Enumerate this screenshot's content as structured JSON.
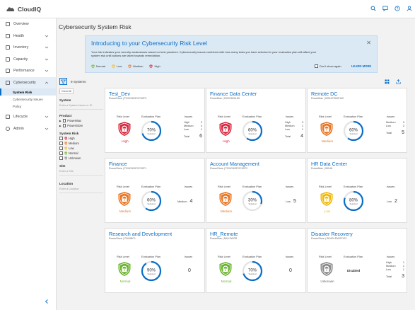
{
  "app": {
    "name": "CloudIQ"
  },
  "sidebar": {
    "items": [
      {
        "label": "Overview",
        "icon": "overview-icon",
        "chevron": false
      },
      {
        "label": "Health",
        "icon": "health-icon",
        "chevron": true
      },
      {
        "label": "Inventory",
        "icon": "inventory-icon",
        "chevron": true
      },
      {
        "label": "Capacity",
        "icon": "capacity-icon",
        "chevron": true
      },
      {
        "label": "Performance",
        "icon": "performance-icon",
        "chevron": true
      },
      {
        "label": "Cybersecurity",
        "icon": "shield-icon",
        "chevron": true
      },
      {
        "label": "Lifecycle",
        "icon": "lifecycle-icon",
        "chevron": true
      },
      {
        "label": "Admin",
        "icon": "gear-icon",
        "chevron": true
      }
    ],
    "sub_items": [
      "System Risk",
      "Cybersecurity Issues",
      "Policy"
    ]
  },
  "page": {
    "title": "Cybersecurity System Risk"
  },
  "banner": {
    "title": "Introducing to your Cybersecurity Risk Level",
    "text": "Your risk indicates your security weaknesses based on best practices. Cybersecurity issues combined with how many tests you have selected in your evaluation plan will affect your system risk until actions are taken towards remediation.",
    "legend": [
      "Normal",
      "Low",
      "Medium",
      "High"
    ],
    "dont_show": "Don't show again",
    "learn_more": "LEARN MORE"
  },
  "filters": {
    "count": "9 Systems",
    "clear_all": "Clear All",
    "system_label": "System",
    "system_placeholder": "Enter a System Name or ID",
    "product_label": "Product",
    "products": [
      "PowerMax",
      "PowerStore"
    ],
    "risk_label": "System Risk",
    "risks": [
      "High",
      "Medium",
      "Low",
      "Normal",
      "Unknown"
    ],
    "site_label": "Site",
    "site_placeholder": "Enter a Site",
    "location_label": "Location",
    "location_placeholder": "Enter a Location"
  },
  "card_headers": {
    "risk": "Risk Level",
    "plan": "Evaluation Plan",
    "issues": "Issues",
    "total": "Total",
    "selected": "Selected"
  },
  "colors": {
    "high": "#d7263d",
    "medium": "#e8731f",
    "low": "#f2b705",
    "normal": "#6ab42d",
    "unknown": "#8a8a8a",
    "accent": "#0b6ec6"
  },
  "systems": [
    {
      "name": "Test_Dev",
      "sub": "PowerStore | FCNCH0972C02F3",
      "risk": "High",
      "risk_color": "#d7263d",
      "plan": "70%",
      "plan_frac": 0.7,
      "issues": [
        {
          "label": "High",
          "value": "2"
        },
        {
          "label": "Medium",
          "value": "3"
        },
        {
          "label": "Low",
          "value": "1"
        }
      ],
      "total": "6"
    },
    {
      "name": "Finance Data Center",
      "sub": "PowerMax | 00197620L63",
      "risk": "High",
      "risk_color": "#d7263d",
      "plan": "60%",
      "plan_frac": 0.6,
      "issues": [
        {
          "label": "High",
          "value": "3"
        },
        {
          "label": "Medium",
          "value": "1"
        },
        {
          "label": "Low",
          "value": "1"
        }
      ],
      "total": "4"
    },
    {
      "name": "Remote DC",
      "sub": "PowerMax | 000197900F100",
      "risk": "Medium",
      "risk_color": "#e8731f",
      "plan": "60%",
      "plan_frac": 0.6,
      "issues": [
        {
          "label": "Medium",
          "value": "3"
        },
        {
          "label": "Low",
          "value": "2"
        }
      ],
      "total": "5"
    },
    {
      "name": "Finance",
      "sub": "PowerStore | FCNCH0972C02F1",
      "risk": "Medium",
      "risk_color": "#e8731f",
      "plan": "60%",
      "plan_frac": 0.6,
      "single": {
        "label": "Medium",
        "value": "4"
      }
    },
    {
      "name": "Account Management",
      "sub": "PowerStore | FCNCH0972C02F2",
      "risk": "Medium",
      "risk_color": "#e8731f",
      "plan": "30%",
      "plan_frac": 0.3,
      "single": {
        "label": "Low",
        "value": "5"
      }
    },
    {
      "name": "HR Data Center",
      "sub": "PowerMax | 95148",
      "risk": "Low",
      "risk_color": "#f2b705",
      "plan": "80%",
      "plan_frac": 0.8,
      "single": {
        "label": "Low",
        "value": "2"
      }
    },
    {
      "name": "Research and Development",
      "sub": "PowerStore | CNL8BC1",
      "risk": "Normal",
      "risk_color": "#6ab42d",
      "plan": "90%",
      "plan_frac": 0.9,
      "zero": "0"
    },
    {
      "name": "HR_Remote",
      "sub": "PowerMax | MUL2WOR",
      "risk": "Normal",
      "risk_color": "#6ab42d",
      "plan": "70%",
      "plan_frac": 0.7,
      "zero": "0"
    },
    {
      "name": "Disaster Recovery",
      "sub": "PowerStore | DLMSLFA02F123",
      "risk": "Unknown",
      "risk_color": "#8a8a8a",
      "plan_status": "Disabled",
      "issues": [
        {
          "label": "High",
          "value": "1"
        },
        {
          "label": "Medium",
          "value": "1"
        },
        {
          "label": "Low",
          "value": "1"
        }
      ],
      "total": "3"
    }
  ]
}
